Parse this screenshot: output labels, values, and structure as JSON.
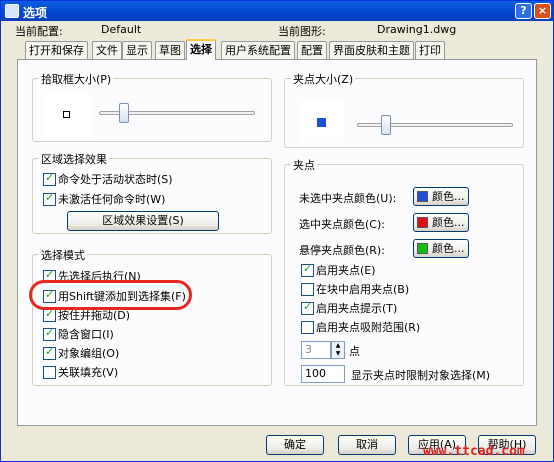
{
  "window": {
    "title": "选项",
    "help_glyph": "?",
    "close_glyph": "×"
  },
  "config": {
    "current_profile_label": "当前配置:",
    "current_profile_value": "Default",
    "current_drawing_label": "当前图形:",
    "current_drawing_value": "Drawing1.dwg"
  },
  "tabs": [
    "打开和保存",
    "文件",
    "显示",
    "草图",
    "选择",
    "用户系统配置",
    "配置",
    "界面皮肤和主题",
    "打印"
  ],
  "active_tab": "选择",
  "pickbox": {
    "title": "拾取框大小(P)",
    "level": 0.28
  },
  "selection_preview": {
    "title": "区域选择效果",
    "options": [
      {
        "label": "命令处于活动状态时(S)",
        "checked": true
      },
      {
        "label": "未激活任何命令时(W)",
        "checked": true
      }
    ],
    "settings_button": "区域效果设置(S)"
  },
  "selection_modes": {
    "title": "选择模式",
    "options": [
      {
        "label": "先选择后执行(N)",
        "checked": true
      },
      {
        "label": "用Shift键添加到选择集(F)",
        "checked": true
      },
      {
        "label": "按住并拖动(D)",
        "checked": true
      },
      {
        "label": "隐含窗口(I)",
        "checked": true
      },
      {
        "label": "对象编组(O)",
        "checked": true
      },
      {
        "label": "关联填充(V)",
        "checked": false
      }
    ]
  },
  "grip_size": {
    "title": "夹点大小(Z)",
    "level": 0.42
  },
  "grips": {
    "title": "夹点",
    "colors": [
      {
        "label": "未选中夹点颜色(U):",
        "button": "颜色...",
        "color": "#1e4fd8"
      },
      {
        "label": "选中夹点颜色(C):",
        "button": "颜色...",
        "color": "#e01010"
      },
      {
        "label": "悬停夹点颜色(R):",
        "button": "颜色...",
        "color": "#12c012"
      }
    ],
    "options": [
      {
        "label": "启用夹点(E)",
        "checked": true
      },
      {
        "label": "在块中启用夹点(B)",
        "checked": false
      },
      {
        "label": "启用夹点提示(T)",
        "checked": true
      },
      {
        "label": "启用夹点吸附范围(R)",
        "checked": false
      }
    ],
    "point_value": "3",
    "point_label": "点",
    "limit_value": "100",
    "limit_label": "显示夹点时限制对象选择(M)"
  },
  "footer": {
    "ok": "确定",
    "cancel": "取消",
    "apply": "应用(A)",
    "help": "帮助(H)"
  },
  "watermark": "www.ttcad.com"
}
